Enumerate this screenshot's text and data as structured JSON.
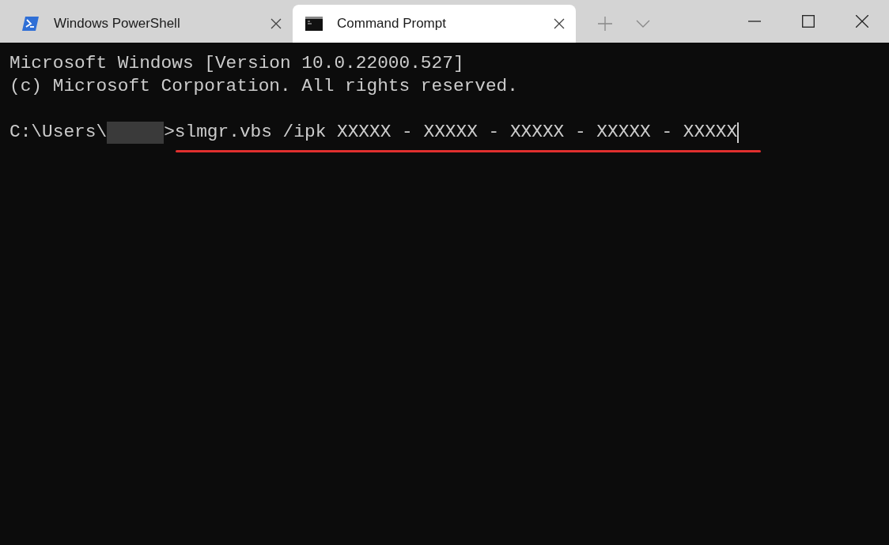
{
  "tabs": [
    {
      "title": "Windows PowerShell",
      "kind": "powershell",
      "selected": false
    },
    {
      "title": "Command Prompt",
      "kind": "cmd",
      "selected": true
    }
  ],
  "terminal": {
    "lines": [
      "Microsoft Windows [Version 10.0.22000.527]",
      "(c) Microsoft Corporation. All rights reserved."
    ],
    "prompt": {
      "path": "C:\\Users\\",
      "redacted": true,
      "command": ">slmgr.vbs /ipk XXXXX - XXXXX - XXXXX - XXXXX - XXXXX",
      "highlighted": true
    }
  }
}
